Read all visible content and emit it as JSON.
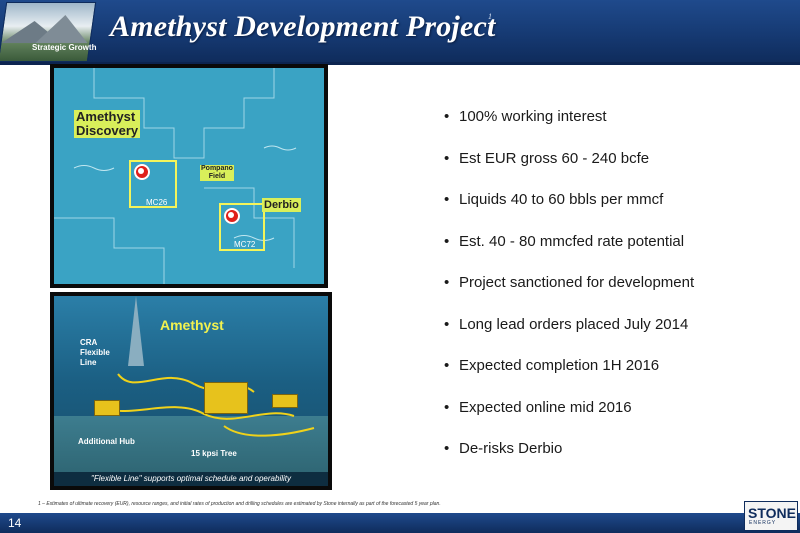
{
  "header": {
    "logo_label": "Strategic Growth",
    "title": "Amethyst Development Project",
    "title_sup": "1"
  },
  "map": {
    "discovery_label": "Amethyst\nDiscovery",
    "pompano_label": "Pompano\nField",
    "derbio_label": "Derbio",
    "mc26_label": "MC26",
    "mc72_label": "MC72"
  },
  "subsea": {
    "tag": "Amethyst",
    "cra_label": "CRA\nFlexible\nLine",
    "additional_hub_label": "Additional Hub",
    "tree_label": "15 kpsi Tree",
    "caption": "\"Flexible Line\" supports optimal schedule and operability"
  },
  "bullets": [
    "100% working interest",
    "Est EUR gross 60 - 240 bcfe",
    "Liquids 40 to 60 bbls per mmcf",
    "Est. 40 - 80 mmcfed rate potential",
    "Project sanctioned for development",
    "Long lead orders placed July 2014",
    "Expected completion 1H 2016",
    "Expected online mid 2016",
    "De-risks Derbio"
  ],
  "footnote": "1 – Estimates of ultimate recovery (EUR), resource ranges, and initial rates of production and drilling schedules are estimated by Stone internally as part of the forecasted 5 year plan.",
  "footer": {
    "page_number": "14",
    "brand": "STONE",
    "brand_sub": "ENERGY"
  }
}
